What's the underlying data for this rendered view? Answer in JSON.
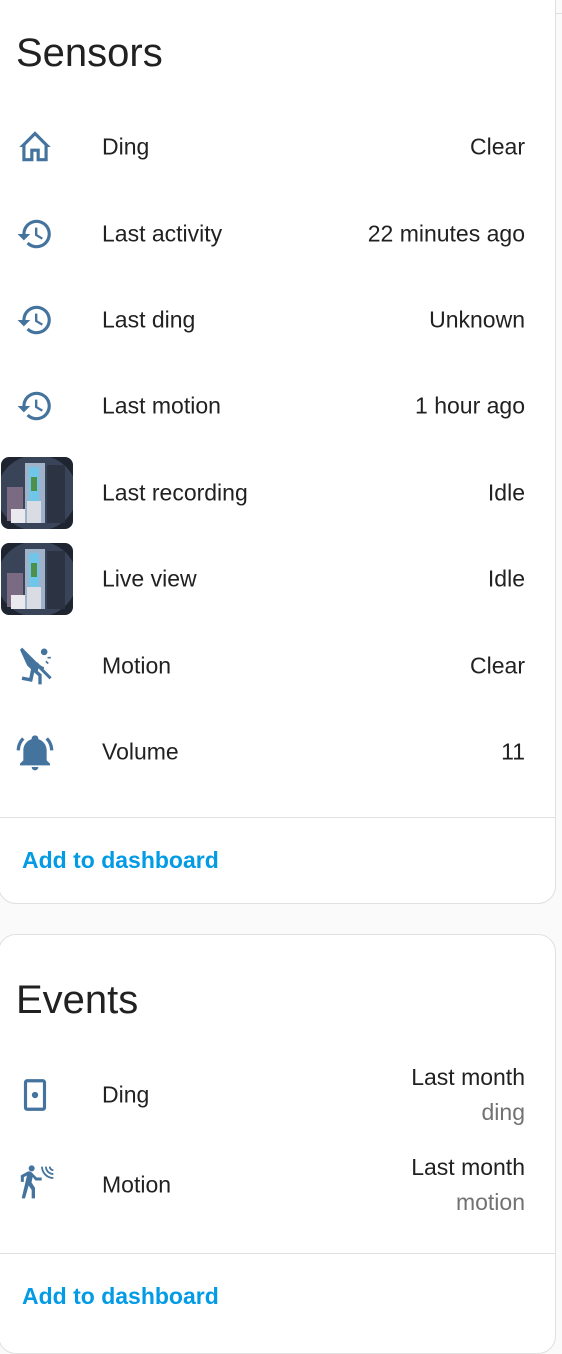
{
  "icon_color": "#44739e",
  "link_color": "#039be5",
  "sensors": {
    "title": "Sensors",
    "rows": [
      {
        "icon": "home-outline-icon",
        "label": "Ding",
        "value": "Clear"
      },
      {
        "icon": "history-icon",
        "label": "Last activity",
        "value": "22 minutes ago"
      },
      {
        "icon": "history-icon",
        "label": "Last ding",
        "value": "Unknown"
      },
      {
        "icon": "history-icon",
        "label": "Last motion",
        "value": "1 hour ago"
      },
      {
        "icon": "camera-thumbnail",
        "label": "Last recording",
        "value": "Idle"
      },
      {
        "icon": "camera-thumbnail",
        "label": "Live view",
        "value": "Idle"
      },
      {
        "icon": "motion-sensor-off-icon",
        "label": "Motion",
        "value": "Clear"
      },
      {
        "icon": "bell-ring-icon",
        "label": "Volume",
        "value": "11"
      }
    ],
    "add_label": "Add to dashboard"
  },
  "events": {
    "title": "Events",
    "rows": [
      {
        "icon": "doorbell-icon",
        "label": "Ding",
        "value": "Last month",
        "sub": "ding"
      },
      {
        "icon": "motion-sensor-icon",
        "label": "Motion",
        "value": "Last month",
        "sub": "motion"
      }
    ],
    "add_label": "Add to dashboard"
  }
}
